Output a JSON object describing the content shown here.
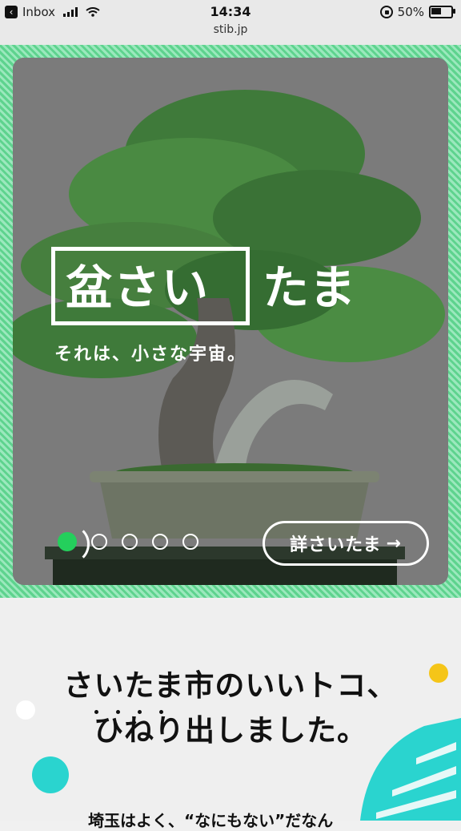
{
  "status_bar": {
    "back_app": "Inbox",
    "time": "14:34",
    "url": "stib.jp",
    "battery": "50%",
    "battery_level": 0.5
  },
  "hero": {
    "logo_boxed": "盆さい",
    "logo_rest": "たま",
    "tagline": "それは、小さな宇宙。",
    "more_button": "詳さいたま",
    "arrow": "→",
    "slides": 5,
    "active_slide": 1
  },
  "intro": {
    "headline_line1": "さいたま市のいいトコ、",
    "headline_line2": "ひねり出しました。",
    "teaser": "埼玉はよく、“なにもない”だなん"
  },
  "colors": {
    "accent_green": "#24cf5c",
    "frame_green": "#5ed38e",
    "deco_yellow": "#f5c518",
    "deco_cyan": "#2ad4cf"
  }
}
